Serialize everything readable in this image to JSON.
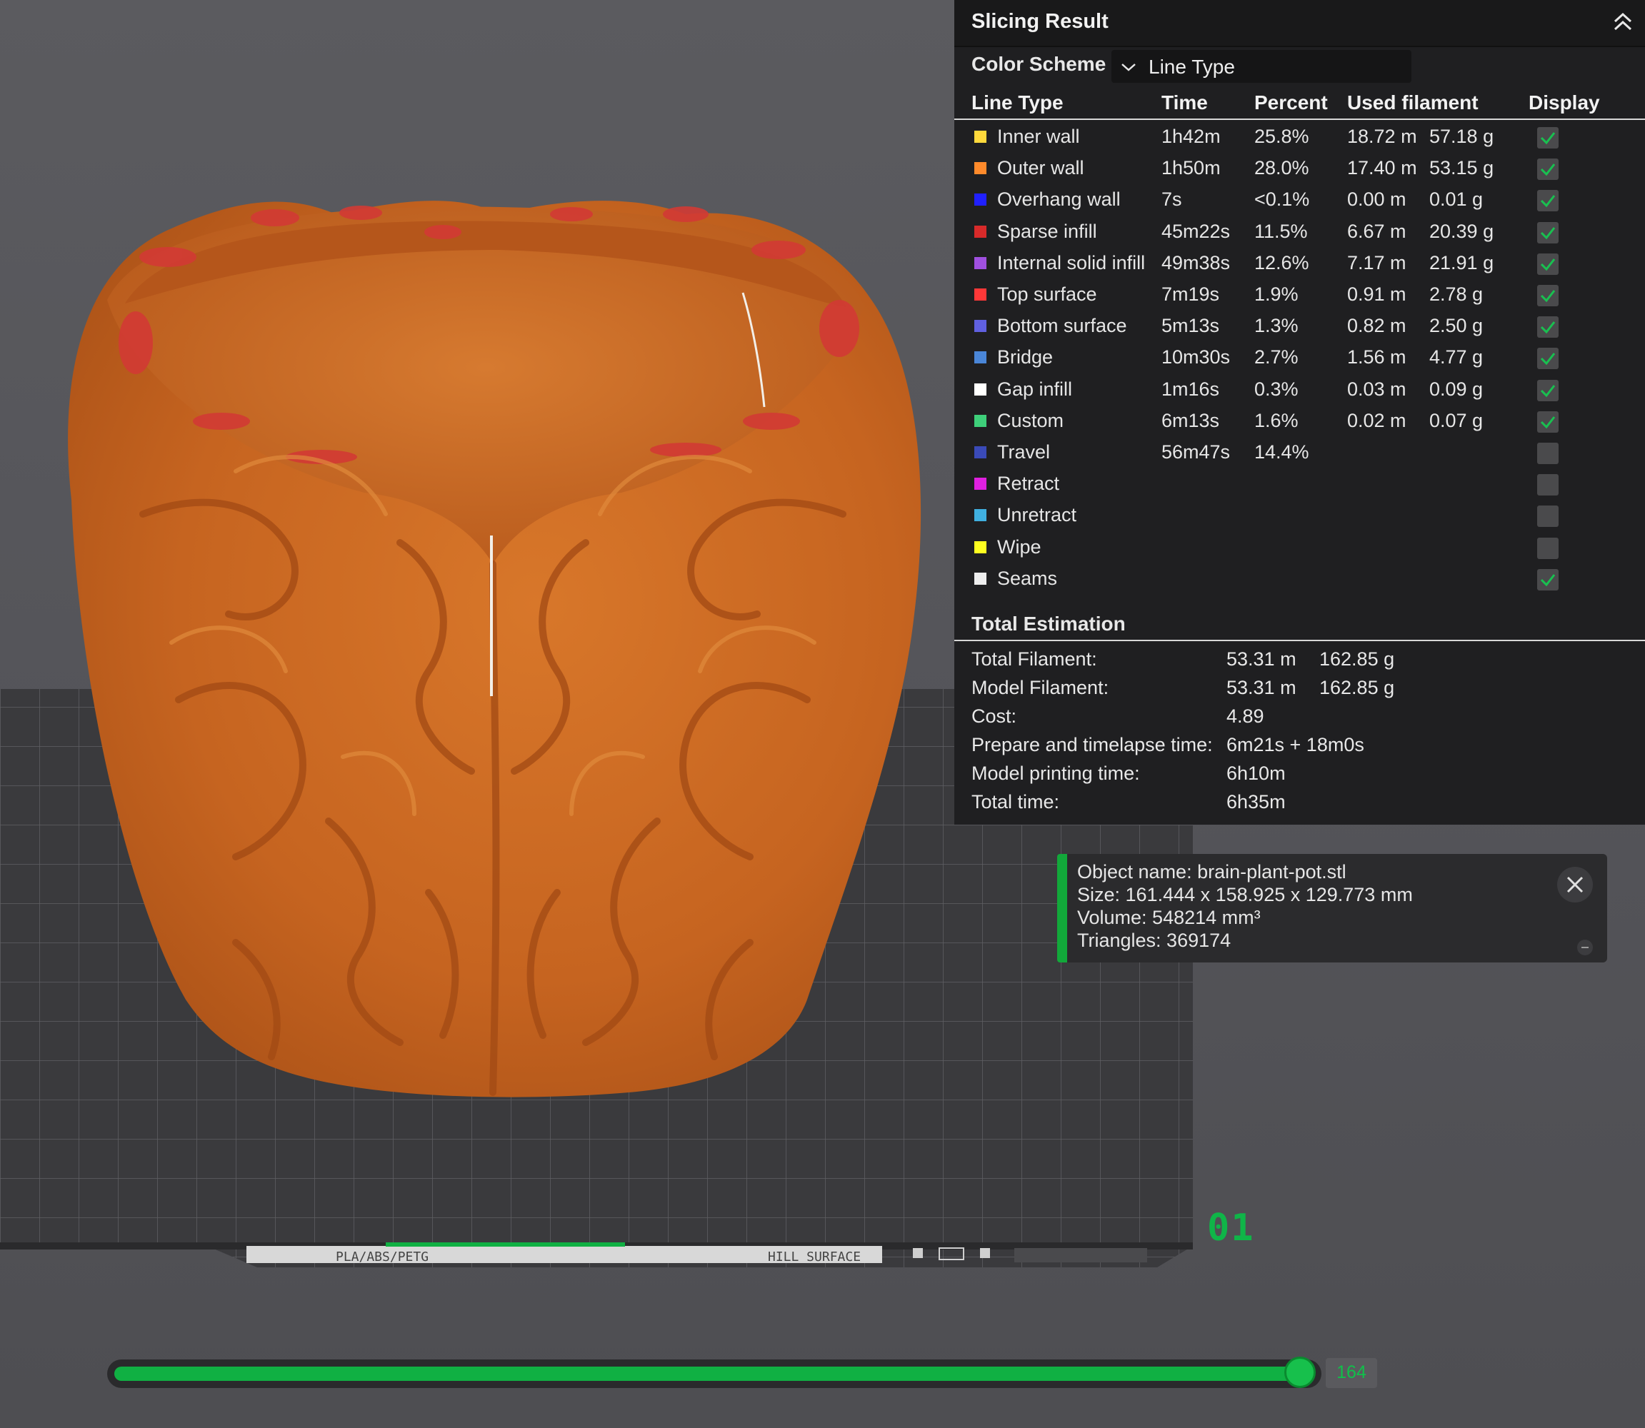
{
  "panel": {
    "title": "Slicing Result",
    "color_scheme_label": "Color Scheme",
    "color_scheme_value": "Line Type",
    "headers": {
      "line_type": "Line Type",
      "time": "Time",
      "percent": "Percent",
      "used_filament": "Used filament",
      "display": "Display"
    },
    "rows": [
      {
        "name": "Inner wall",
        "color": "#ffd93c",
        "time": "1h42m",
        "percent": "25.8%",
        "length": "18.72 m",
        "weight": "57.18 g",
        "display": true
      },
      {
        "name": "Outer wall",
        "color": "#ff8a2b",
        "time": "1h50m",
        "percent": "28.0%",
        "length": "17.40 m",
        "weight": "53.15 g",
        "display": true
      },
      {
        "name": "Overhang wall",
        "color": "#2020ff",
        "time": "7s",
        "percent": "<0.1%",
        "length": "0.00 m",
        "weight": "0.01 g",
        "display": true
      },
      {
        "name": "Sparse infill",
        "color": "#d82a2a",
        "time": "45m22s",
        "percent": "11.5%",
        "length": "6.67 m",
        "weight": "20.39 g",
        "display": true
      },
      {
        "name": "Internal solid infill",
        "color": "#a050e0",
        "time": "49m38s",
        "percent": "12.6%",
        "length": "7.17 m",
        "weight": "21.91 g",
        "display": true
      },
      {
        "name": "Top surface",
        "color": "#ff3838",
        "time": "7m19s",
        "percent": "1.9%",
        "length": "0.91 m",
        "weight": "2.78 g",
        "display": true
      },
      {
        "name": "Bottom surface",
        "color": "#6060e0",
        "time": "5m13s",
        "percent": "1.3%",
        "length": "0.82 m",
        "weight": "2.50 g",
        "display": true
      },
      {
        "name": "Bridge",
        "color": "#4a86d8",
        "time": "10m30s",
        "percent": "2.7%",
        "length": "1.56 m",
        "weight": "4.77 g",
        "display": true
      },
      {
        "name": "Gap infill",
        "color": "#ffffff",
        "time": "1m16s",
        "percent": "0.3%",
        "length": "0.03 m",
        "weight": "0.09 g",
        "display": true
      },
      {
        "name": "Custom",
        "color": "#3ecf7a",
        "time": "6m13s",
        "percent": "1.6%",
        "length": "0.02 m",
        "weight": "0.07 g",
        "display": true
      },
      {
        "name": "Travel",
        "color": "#3a4ab8",
        "time": "56m47s",
        "percent": "14.4%",
        "length": "",
        "weight": "",
        "display": false
      },
      {
        "name": "Retract",
        "color": "#e020e0",
        "time": "",
        "percent": "",
        "length": "",
        "weight": "",
        "display": false
      },
      {
        "name": "Unretract",
        "color": "#40b0e0",
        "time": "",
        "percent": "",
        "length": "",
        "weight": "",
        "display": false
      },
      {
        "name": "Wipe",
        "color": "#ffff20",
        "time": "",
        "percent": "",
        "length": "",
        "weight": "",
        "display": false
      },
      {
        "name": "Seams",
        "color": "#eeeeee",
        "time": "",
        "percent": "",
        "length": "",
        "weight": "",
        "display": true
      }
    ],
    "total_title": "Total Estimation",
    "totals": [
      {
        "label": "Total Filament:",
        "v1": "53.31 m",
        "v2": "162.85 g"
      },
      {
        "label": "Model Filament:",
        "v1": "53.31 m",
        "v2": "162.85 g"
      },
      {
        "label": "Cost:",
        "v1": "4.89",
        "v2": ""
      },
      {
        "label": "Prepare and timelapse time:",
        "v1": "6m21s + 18m0s",
        "v2": ""
      },
      {
        "label": "Model printing time:",
        "v1": "6h10m",
        "v2": ""
      },
      {
        "label": "Total time:",
        "v1": "6h35m",
        "v2": ""
      }
    ]
  },
  "object_info": {
    "name_line": "Object name: brain-plant-pot.stl",
    "size_line": "Size: 161.444 x 158.925 x 129.773 mm",
    "volume_line": "Volume: 548214 mm³",
    "triangles_line": "Triangles: 369174"
  },
  "plate": {
    "number": "01",
    "material_text": "PLA/ABS/PETG",
    "surface_text": "HILL SURFACE"
  },
  "layer_slider": {
    "value": "164",
    "fill_fraction": 0.98
  },
  "colors": {
    "accent": "#10b043",
    "model": "#c9631f",
    "panel_bg": "#1f1f21"
  }
}
